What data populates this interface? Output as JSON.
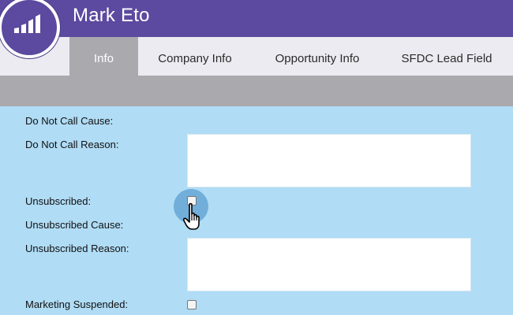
{
  "header": {
    "title": "Mark Eto"
  },
  "logo": {
    "icon": "marketo-bars-logo"
  },
  "tabs": [
    {
      "label": "Info",
      "active": true
    },
    {
      "label": "Company Info",
      "active": false
    },
    {
      "label": "Opportunity Info",
      "active": false
    },
    {
      "label": "SFDC Lead Field",
      "active": false
    }
  ],
  "form": {
    "do_not_call_cause_label": "Do Not Call Cause:",
    "do_not_call_reason_label": "Do Not Call Reason:",
    "do_not_call_reason_value": "",
    "unsubscribed_label": "Unsubscribed:",
    "unsubscribed_checked": false,
    "unsubscribed_cause_label": "Unsubscribed Cause:",
    "unsubscribed_reason_label": "Unsubscribed Reason:",
    "unsubscribed_reason_value": "",
    "marketing_suspended_label": "Marketing Suspended:",
    "marketing_suspended_checked": false
  },
  "colors": {
    "header": "#5b4a9f",
    "tab_bar": "#ecebf1",
    "active_tab": "#aaa9ae",
    "content_bg": "#b0dcf5"
  }
}
